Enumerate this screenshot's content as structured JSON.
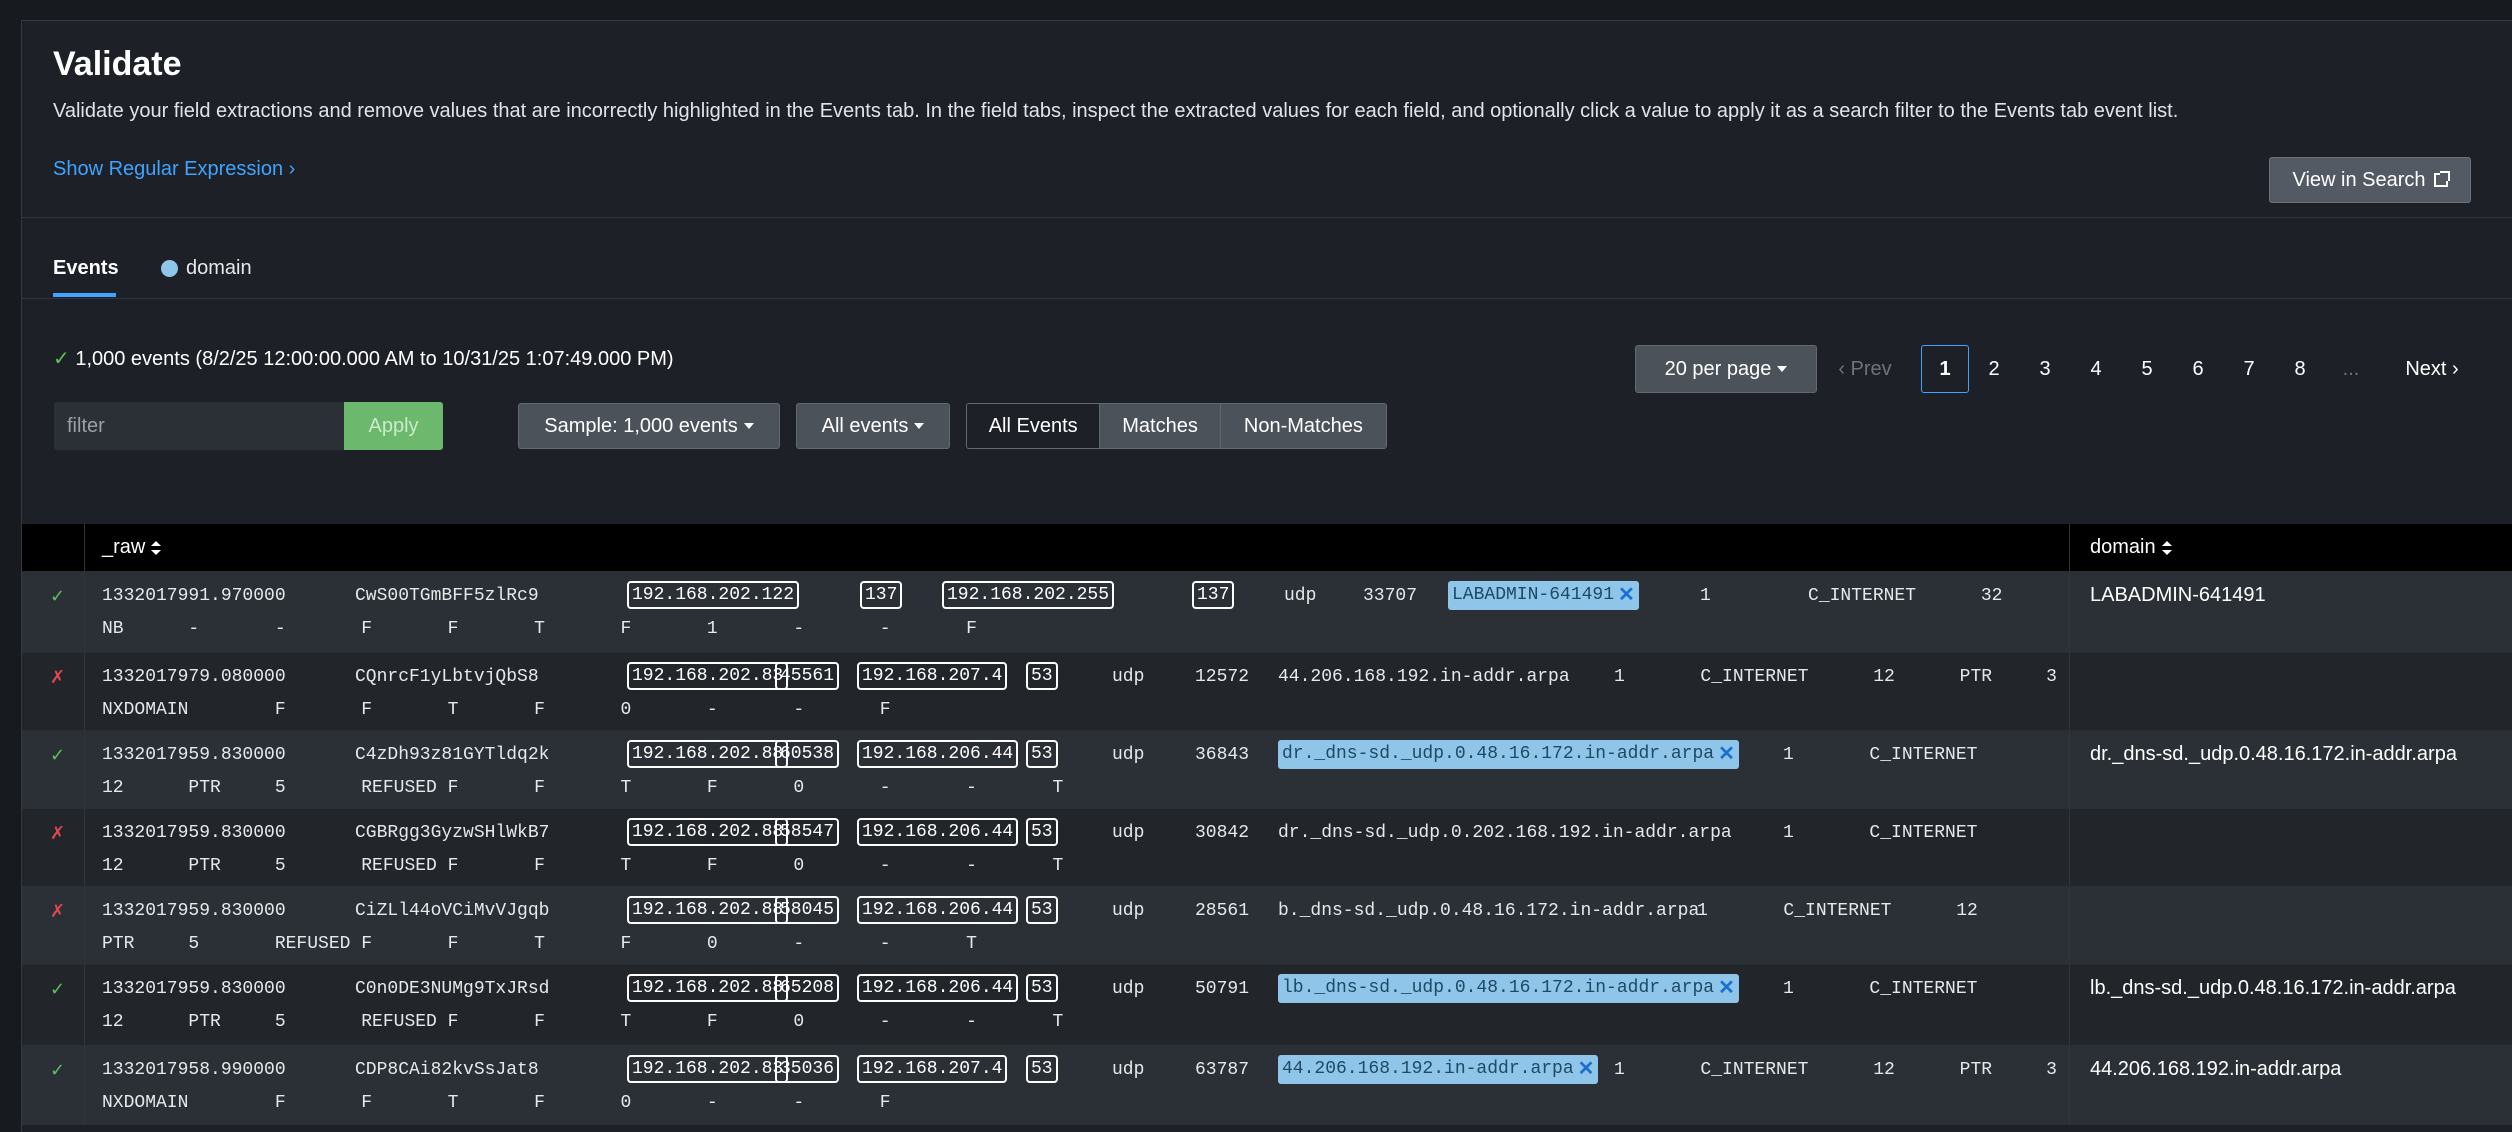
{
  "header": {
    "title": "Validate",
    "description": "Validate your field extractions and remove values that are incorrectly highlighted in the Events tab. In the field tabs, inspect the extracted values for each field, and optionally click a value to apply it as a search filter to the Events tab event list.",
    "regex_link": "Show Regular Expression ›",
    "view_in_search": "View in Search"
  },
  "tabs": [
    {
      "label": "Events",
      "active": true
    },
    {
      "label": "domain",
      "color": "#8ec5e8"
    }
  ],
  "summary": {
    "check": "✓",
    "text": "1,000 events (8/2/25 12:00:00.000 AM to 10/31/25 1:07:49.000 PM)"
  },
  "filter": {
    "placeholder": "filter",
    "apply": "Apply"
  },
  "controls": {
    "sample": "Sample: 1,000 events",
    "all_events_dropdown": "All events",
    "segment": [
      "All Events",
      "Matches",
      "Non-Matches"
    ]
  },
  "pagination": {
    "per_page": "20 per page",
    "prev": "‹ Prev",
    "pages": [
      "1",
      "2",
      "3",
      "4",
      "5",
      "6",
      "7",
      "8",
      "..."
    ],
    "current": "1",
    "next": "Next ›"
  },
  "table": {
    "columns": [
      "_raw",
      "domain"
    ],
    "rows": [
      {
        "status": "✓",
        "ts": "1332017991.970000",
        "uid": "CwS00TGmBFF5zlRc9",
        "src_ip": "192.168.202.122",
        "src_port": "137",
        "dst_ip": "192.168.202.255",
        "dst_port": "137",
        "proto": "udp",
        "trans": "33707",
        "query": "LABADMIN-641491",
        "rest": "1         C_INTERNET      32",
        "line2": "NB      -       -       F       F       T       F       1       -       -       F",
        "domain": "LABADMIN-641491"
      },
      {
        "status": "✗",
        "ts": "1332017979.080000",
        "uid": "CQnrcF1yLbtvjQbS8",
        "src_ip": "192.168.202.83",
        "src_port": "45561",
        "dst_ip": "192.168.207.4",
        "dst_port": "53",
        "proto": "udp",
        "trans": "12572",
        "query": "44.206.168.192.in-addr.arpa",
        "rest": "1       C_INTERNET      12      PTR     3",
        "line2": "NXDOMAIN        F       F       T       F       0       -       -       F",
        "domain": ""
      },
      {
        "status": "✓",
        "ts": "1332017959.830000",
        "uid": "C4zDh93z81GYTldq2k",
        "src_ip": "192.168.202.88",
        "src_port": "60538",
        "dst_ip": "192.168.206.44",
        "dst_port": "53",
        "proto": "udp",
        "trans": "36843",
        "query": "dr._dns-sd._udp.0.48.16.172.in-addr.arpa",
        "rest": "1       C_INTERNET",
        "line2": "12      PTR     5       REFUSED F       F       T       F       0       -       -       T",
        "domain": "dr._dns-sd._udp.0.48.16.172.in-addr.arpa"
      },
      {
        "status": "✗",
        "ts": "1332017959.830000",
        "uid": "CGBRgg3GyzwSHlWkB7",
        "src_ip": "192.168.202.88",
        "src_port": "58547",
        "dst_ip": "192.168.206.44",
        "dst_port": "53",
        "proto": "udp",
        "trans": "30842",
        "query": "dr._dns-sd._udp.0.202.168.192.in-addr.arpa",
        "rest": "1       C_INTERNET",
        "line2": "12      PTR     5       REFUSED F       F       T       F       0       -       -       T",
        "domain": ""
      },
      {
        "status": "✗",
        "ts": "1332017959.830000",
        "uid": "CiZLl44oVCiMvVJgqb",
        "src_ip": "192.168.202.88",
        "src_port": "58045",
        "dst_ip": "192.168.206.44",
        "dst_port": "53",
        "proto": "udp",
        "trans": "28561",
        "query": "b._dns-sd._udp.0.48.16.172.in-addr.arpa",
        "rest": "1       C_INTERNET      12",
        "line2": "PTR     5       REFUSED F       F       T       F       0       -       -       T",
        "domain": ""
      },
      {
        "status": "✓",
        "ts": "1332017959.830000",
        "uid": "C0n0DE3NUMg9TxJRsd",
        "src_ip": "192.168.202.88",
        "src_port": "65208",
        "dst_ip": "192.168.206.44",
        "dst_port": "53",
        "proto": "udp",
        "trans": "50791",
        "query": "lb._dns-sd._udp.0.48.16.172.in-addr.arpa",
        "rest": "1       C_INTERNET",
        "line2": "12      PTR     5       REFUSED F       F       T       F       0       -       -       T",
        "domain": "lb._dns-sd._udp.0.48.16.172.in-addr.arpa"
      },
      {
        "status": "✓",
        "ts": "1332017958.990000",
        "uid": "CDP8CAi82kvSsJat8",
        "src_ip": "192.168.202.83",
        "src_port": "35036",
        "dst_ip": "192.168.207.4",
        "dst_port": "53",
        "proto": "udp",
        "trans": "63787",
        "query": "44.206.168.192.in-addr.arpa",
        "rest": "1       C_INTERNET      12      PTR     3",
        "line2": "NXDOMAIN        F       F       T       F       0       -       -       F",
        "domain": "44.206.168.192.in-addr.arpa"
      }
    ]
  },
  "colors": {
    "accent": "#3fa4ff",
    "match": "#5cc05c",
    "nonmatch": "#e0474c",
    "field_highlight": "#8ec5e8"
  }
}
